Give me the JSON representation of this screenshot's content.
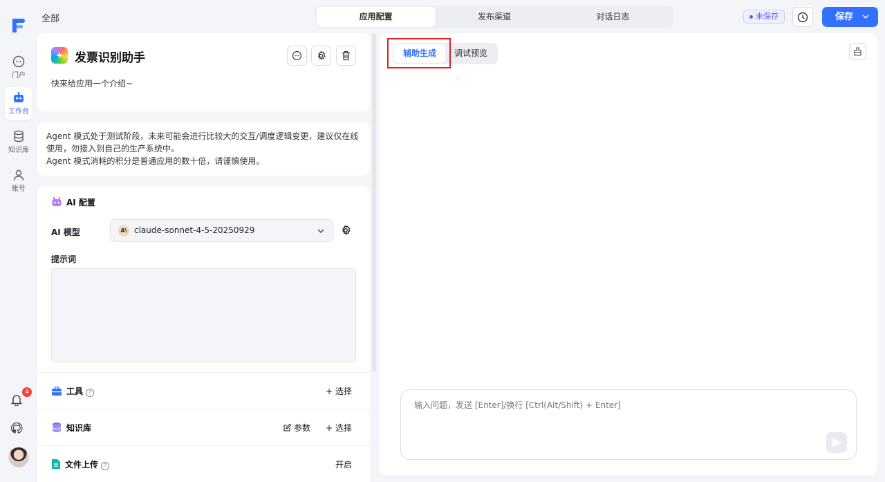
{
  "sidebar": {
    "items": [
      {
        "label": "门户",
        "icon": "chat-bubble-icon"
      },
      {
        "label": "工作台",
        "icon": "robot-icon"
      },
      {
        "label": "知识库",
        "icon": "database-icon"
      },
      {
        "label": "账号",
        "icon": "user-icon"
      }
    ],
    "notification_count": "4"
  },
  "header": {
    "breadcrumb": "全部",
    "tabs": [
      "应用配置",
      "发布渠道",
      "对话日志"
    ],
    "active_tab": "应用配置",
    "status": "未保存",
    "save_label": "保存"
  },
  "app": {
    "title": "发票识别助手",
    "description": "快来给应用一个介绍~"
  },
  "warning": {
    "line1": "Agent 模式处于测试阶段，未来可能会进行比较大的交互/调度逻辑变更，建议仅在线使用，勿接入到自己的生产系统中。",
    "line2": "Agent 模式消耗的积分是普通应用的数十倍，请谨慎使用。"
  },
  "ai_config": {
    "section_title": "AI 配置",
    "model_label": "AI 模型",
    "model_icon_text": "A\\",
    "model_value": "claude-sonnet-4-5-20250929",
    "prompt_label": "提示词",
    "prompt_value": ""
  },
  "rows": {
    "tools": {
      "title": "工具",
      "action": "+ 选择"
    },
    "knowledge": {
      "title": "知识库",
      "params": "参数",
      "action": "+ 选择"
    },
    "file_upload": {
      "title": "文件上传",
      "action": "开启"
    }
  },
  "right_panel": {
    "tabs": [
      "辅助生成",
      "调试预览"
    ],
    "active_tab": "辅助生成",
    "input_placeholder": "输入问题，发送 [Enter]/换行 [Ctrl(Alt/Shift) + Enter]"
  },
  "colors": {
    "accent": "#3370ff",
    "highlight": "#e02020",
    "badge": "#f04438"
  }
}
